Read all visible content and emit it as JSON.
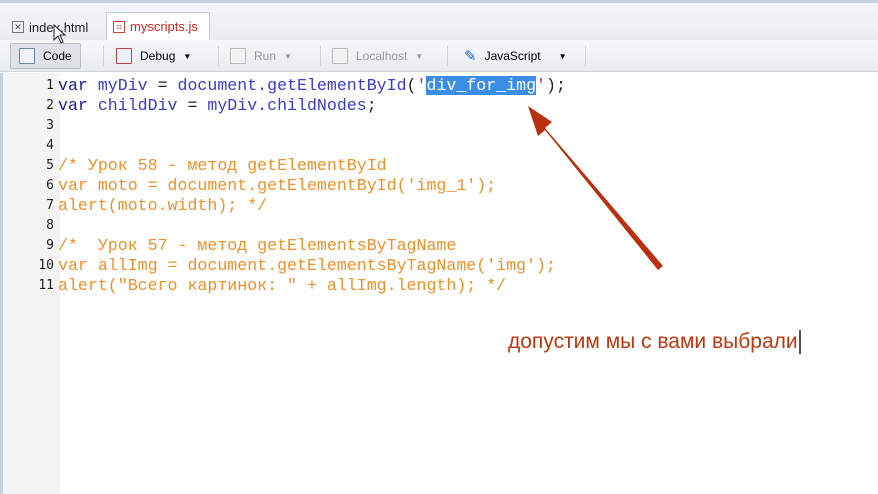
{
  "tabs": [
    {
      "label": "index.html",
      "active": false
    },
    {
      "label": "myscripts.js",
      "active": true
    }
  ],
  "toolbar": {
    "code": "Code",
    "debug": "Debug",
    "run": "Run",
    "localhost": "Localhost",
    "language": "JavaScript"
  },
  "code_lines": [
    {
      "n": "1",
      "parts": [
        [
          "kw",
          "var "
        ],
        [
          "id",
          "myDiv"
        ],
        [
          "plain",
          " = "
        ],
        [
          "id",
          "document.getElementById"
        ],
        [
          "plain",
          "("
        ],
        [
          "str",
          "'"
        ],
        [
          "sel",
          "div_for_img"
        ],
        [
          "str",
          "'"
        ],
        [
          "plain",
          ");"
        ]
      ]
    },
    {
      "n": "2",
      "parts": [
        [
          "kw",
          "var "
        ],
        [
          "id",
          "childDiv"
        ],
        [
          "plain",
          " = "
        ],
        [
          "id",
          "myDiv.childNodes"
        ],
        [
          "plain",
          ";"
        ]
      ]
    },
    {
      "n": "3",
      "parts": []
    },
    {
      "n": "4",
      "parts": []
    },
    {
      "n": "5",
      "parts": [
        [
          "cm",
          "/* Урок 58 - метод getElementById"
        ]
      ]
    },
    {
      "n": "6",
      "parts": [
        [
          "cm",
          "var moto = document.getElementById('img_1');"
        ]
      ]
    },
    {
      "n": "7",
      "parts": [
        [
          "cm",
          "alert(moto.width); */"
        ]
      ]
    },
    {
      "n": "8",
      "parts": []
    },
    {
      "n": "9",
      "parts": [
        [
          "cm",
          "/*  Урок 57 - метод getElementsByTagName"
        ]
      ]
    },
    {
      "n": "10",
      "parts": [
        [
          "cm",
          "var allImg = document.getElementsByTagName('img');"
        ]
      ]
    },
    {
      "n": "11",
      "parts": [
        [
          "cm",
          "alert(\"Всего картинок: \" + allImg.length); */"
        ]
      ]
    }
  ],
  "annotation": {
    "text": "допустим мы с вами выбрали",
    "color": "#c0360c"
  }
}
